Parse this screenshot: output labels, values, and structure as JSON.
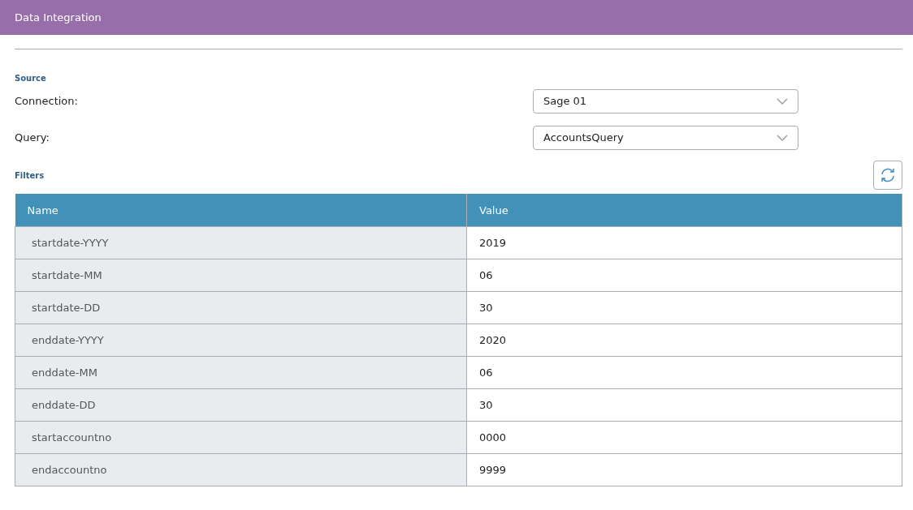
{
  "header": {
    "title": "Data Integration"
  },
  "source": {
    "heading": "Source",
    "fields": [
      {
        "label": "Connection:",
        "value": "Sage 01"
      },
      {
        "label": "Query:",
        "value": "AccountsQuery"
      }
    ]
  },
  "filters": {
    "heading": "Filters",
    "table": {
      "columns": [
        "Name",
        "Value"
      ],
      "rows": [
        [
          "startdate-YYYY",
          "2019"
        ],
        [
          "startdate-MM",
          "06"
        ],
        [
          "startdate-DD",
          "30"
        ],
        [
          "enddate-YYYY",
          "2020"
        ],
        [
          "enddate-MM",
          "06"
        ],
        [
          "enddate-DD",
          "30"
        ],
        [
          "startaccountno",
          "0000"
        ],
        [
          "endaccountno",
          "9999"
        ]
      ]
    }
  }
}
